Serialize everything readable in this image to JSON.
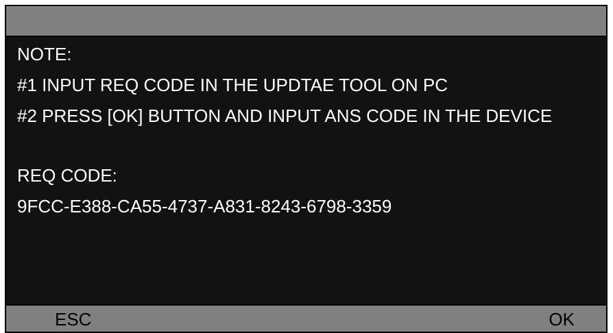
{
  "title_bar": {
    "text": ""
  },
  "note": {
    "heading": "NOTE:",
    "step1": "#1 INPUT REQ CODE IN THE UPDTAE TOOL ON PC",
    "step2": "#2 PRESS [OK] BUTTON AND INPUT ANS CODE IN THE DEVICE"
  },
  "req": {
    "label": "REQ CODE:",
    "code": "9FCC-E388-CA55-4737-A831-8243-6798-3359"
  },
  "softkeys": {
    "left_label": "ESC",
    "right_label": "OK"
  }
}
